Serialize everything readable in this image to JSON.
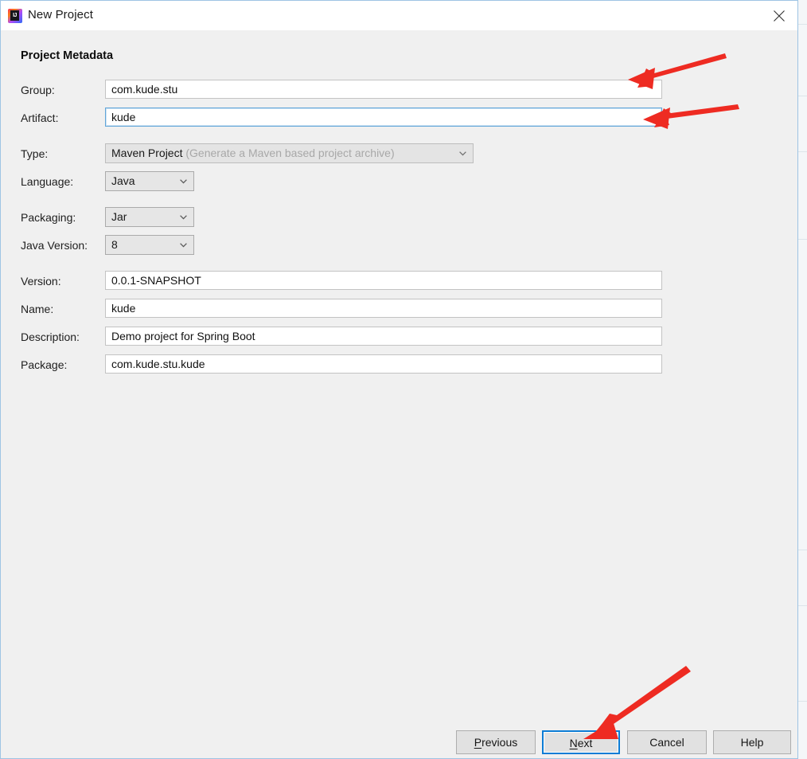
{
  "window": {
    "title": "New Project",
    "app_icon": "intellij-idea-icon",
    "icon_letters": "IJ",
    "close_icon": "close-icon"
  },
  "form": {
    "heading": "Project Metadata",
    "fields": [
      {
        "label": "Group:",
        "value": "com.kude.stu",
        "kind": "text",
        "focused": false
      },
      {
        "label": "Artifact:",
        "value": "kude",
        "kind": "text",
        "focused": true
      },
      {
        "label": "Type:",
        "value": "Maven Project",
        "hint": "(Generate a Maven based project archive)",
        "kind": "dropdown",
        "disabled": true
      },
      {
        "label": "Language:",
        "value": "Java",
        "kind": "dropdown",
        "disabled": false
      },
      {
        "label": "Packaging:",
        "value": "Jar",
        "kind": "dropdown",
        "disabled": false
      },
      {
        "label": "Java Version:",
        "value": "8",
        "kind": "dropdown",
        "disabled": false
      },
      {
        "label": "Version:",
        "value": "0.0.1-SNAPSHOT",
        "kind": "text",
        "focused": false
      },
      {
        "label": "Name:",
        "value": "kude",
        "kind": "text",
        "focused": false
      },
      {
        "label": "Description:",
        "value": "Demo project for Spring Boot",
        "kind": "text",
        "focused": false
      },
      {
        "label": "Package:",
        "value": "com.kude.stu.kude",
        "kind": "text",
        "focused": false
      }
    ]
  },
  "footer": {
    "buttons": [
      {
        "label": "Previous",
        "mnemonic": "P",
        "default": false
      },
      {
        "label": "Next",
        "mnemonic": "N",
        "default": true
      },
      {
        "label": "Cancel",
        "mnemonic": "",
        "default": false
      },
      {
        "label": "Help",
        "mnemonic": "",
        "default": false
      }
    ]
  },
  "annotations": {
    "color": "#ee2b22",
    "arrows": [
      {
        "name": "arrow-to-group-field",
        "points_to": "Group:"
      },
      {
        "name": "arrow-to-artifact-field",
        "points_to": "Artifact:"
      },
      {
        "name": "arrow-to-next-button",
        "points_to": "Next"
      }
    ]
  },
  "colors": {
    "dialog_bg": "#f0f0f0",
    "titlebar_bg": "#ffffff",
    "focus_blue": "#0c7cd5",
    "field_border": "#c3c3c3",
    "annotation_red": "#ee2b22"
  }
}
